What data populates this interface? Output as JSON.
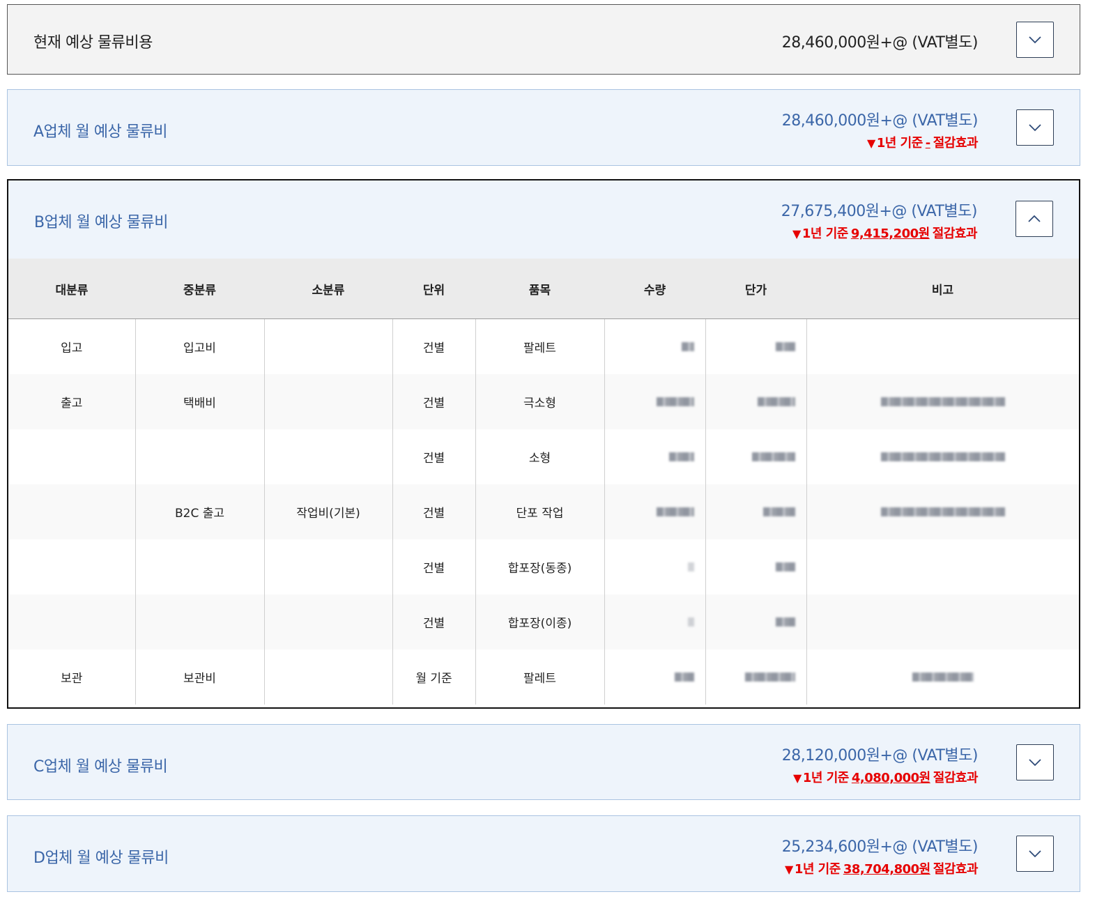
{
  "current": {
    "title": "현재 예상 물류비용",
    "amount": "28,460,000원+@ (VAT별도)"
  },
  "vendors": {
    "a": {
      "title": "A업체 월 예상 물류비",
      "amount": "28,460,000원+@ (VAT별도)",
      "saving_prefix": "1년 기준",
      "saving_value": "-",
      "saving_suffix": "절감효과",
      "expanded": false
    },
    "b": {
      "title": "B업체 월 예상 물류비",
      "amount": "27,675,400원+@ (VAT별도)",
      "saving_prefix": "1년 기준",
      "saving_value": "9,415,200원",
      "saving_suffix": "절감효과",
      "expanded": true
    },
    "c": {
      "title": "C업체 월 예상 물류비",
      "amount": "28,120,000원+@ (VAT별도)",
      "saving_prefix": "1년 기준",
      "saving_value": "4,080,000원",
      "saving_suffix": "절감효과",
      "expanded": false
    },
    "d": {
      "title": "D업체 월 예상 물류비",
      "amount": "25,234,600원+@ (VAT별도)",
      "saving_prefix": "1년 기준",
      "saving_value": "38,704,800원",
      "saving_suffix": "절감효과",
      "expanded": false
    }
  },
  "table": {
    "headers": [
      "대분류",
      "중분류",
      "소분류",
      "단위",
      "품목",
      "수량",
      "단가",
      "비고"
    ],
    "rows": [
      {
        "major": "입고",
        "mid": "입고비",
        "minor": "",
        "unit": "건별",
        "item": "팔레트"
      },
      {
        "major": "출고",
        "mid": "택배비",
        "minor": "",
        "unit": "건별",
        "item": "극소형"
      },
      {
        "major": "",
        "mid": "",
        "minor": "",
        "unit": "건별",
        "item": "소형"
      },
      {
        "major": "",
        "mid": "B2C 출고",
        "minor": "작업비(기본)",
        "unit": "건별",
        "item": "단포 작업"
      },
      {
        "major": "",
        "mid": "",
        "minor": "",
        "unit": "건별",
        "item": "합포장(동종)"
      },
      {
        "major": "",
        "mid": "",
        "minor": "",
        "unit": "건별",
        "item": "합포장(이종)"
      },
      {
        "major": "보관",
        "mid": "보관비",
        "minor": "",
        "unit": "월 기준",
        "item": "팔레트"
      }
    ]
  },
  "colors": {
    "accent_blue": "#3b66a8",
    "saving_red": "#e60000",
    "panel_bg": "#eef4fb"
  },
  "icons": {
    "collapsed": "chevron-down-icon",
    "expanded": "chevron-up-icon"
  }
}
